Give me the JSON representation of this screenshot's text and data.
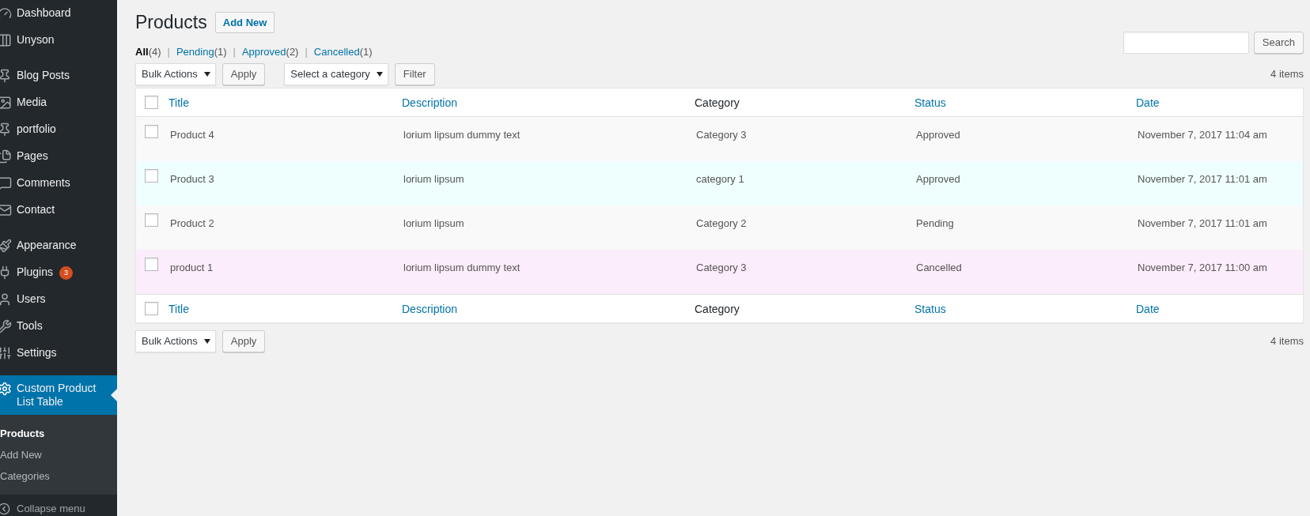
{
  "sidebar": {
    "groups": [
      {
        "items": [
          {
            "label": "Dashboard",
            "selected": false
          },
          {
            "label": "Unyson",
            "selected": false
          }
        ]
      },
      {
        "items": [
          {
            "label": "Blog Posts",
            "selected": false
          },
          {
            "label": "Media",
            "selected": false
          },
          {
            "label": "portfolio",
            "selected": false
          },
          {
            "label": "Pages",
            "selected": false
          },
          {
            "label": "Comments",
            "selected": false
          },
          {
            "label": "Contact",
            "selected": false
          }
        ]
      },
      {
        "items": [
          {
            "label": "Appearance",
            "selected": false
          },
          {
            "label": "Plugins",
            "selected": false,
            "badge": "3"
          },
          {
            "label": "Users",
            "selected": false
          },
          {
            "label": "Tools",
            "selected": false
          },
          {
            "label": "Settings",
            "selected": false
          }
        ]
      },
      {
        "items": [
          {
            "label": "Custom Product List Table",
            "selected": true,
            "children": [
              {
                "label": "Products",
                "selected": true
              },
              {
                "label": "Add New",
                "selected": false
              },
              {
                "label": "Categories",
                "selected": false
              }
            ]
          }
        ]
      }
    ],
    "collapse": "Collapse menu"
  },
  "page": {
    "title": "Products",
    "add_new": "Add New"
  },
  "views": [
    {
      "label": "All",
      "count": "(4)",
      "selected": true
    },
    {
      "separator": "|",
      "label": "Pending",
      "count": "(1)",
      "selected": false
    },
    {
      "separator": "|",
      "label": "Approved",
      "count": "(2)",
      "selected": false
    },
    {
      "separator": "|",
      "label": "Cancelled",
      "count": "(1)",
      "selected": false
    }
  ],
  "search": {
    "button": "Search"
  },
  "top_actions": {
    "bulk": "Bulk Actions",
    "apply": "Apply",
    "category": "Select a category",
    "filter": "Filter",
    "count": "4 items"
  },
  "table": {
    "header_checked": false,
    "footer_checked": false,
    "columns": [
      {
        "label": "Title",
        "sortable": true
      },
      {
        "label": "Description",
        "sortable": true
      },
      {
        "label": "Category",
        "sortable": false
      },
      {
        "label": "Status",
        "sortable": true
      },
      {
        "label": "Date",
        "sortable": true
      }
    ],
    "rows": [
      {
        "checked": false,
        "color": "#f9f9f9",
        "cells": [
          "Product 4",
          "lorium lipsum dummy text",
          "Category 3",
          "Approved",
          "November 7, 2017 11:04 am"
        ]
      },
      {
        "checked": false,
        "color": "#effffe",
        "cells": [
          "Product 3",
          "lorium lipsum",
          "category 1",
          "Approved",
          "November 7, 2017 11:01 am"
        ]
      },
      {
        "checked": false,
        "color": "#f9f9f9",
        "cells": [
          "Product 2",
          "lorium lipsum",
          "Category 2",
          "Pending",
          "November 7, 2017 11:01 am"
        ]
      },
      {
        "checked": false,
        "color": "#fcedfc",
        "cells": [
          "product 1",
          "lorium lipsum dummy text",
          "Category 3",
          "Cancelled",
          "November 7, 2017 11:00 am"
        ]
      }
    ],
    "footer_columns": [
      {
        "label": "Title",
        "sortable": true
      },
      {
        "label": "Description",
        "sortable": true
      },
      {
        "label": "Category",
        "sortable": false
      },
      {
        "label": "Status",
        "sortable": true
      },
      {
        "label": "Date",
        "sortable": true
      }
    ]
  },
  "bottom_actions": {
    "bulk": "Bulk Actions",
    "apply": "Apply",
    "count": "4 items"
  }
}
